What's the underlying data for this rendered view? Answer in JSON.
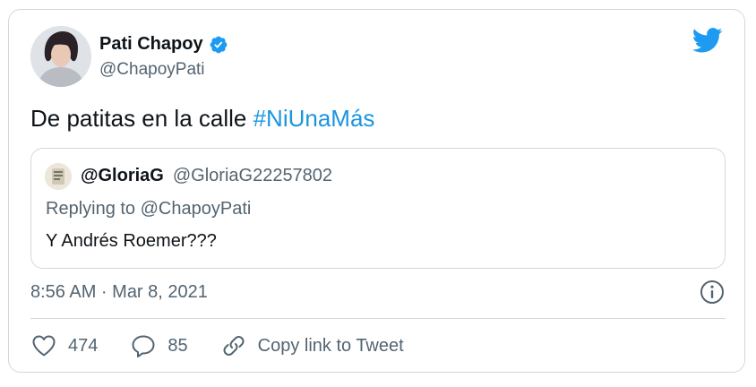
{
  "author": {
    "display_name": "Pati Chapoy",
    "handle": "@ChapoyPati",
    "verified": true
  },
  "tweet": {
    "text": "De patitas en la calle ",
    "hashtag": "#NiUnaMás"
  },
  "quoted": {
    "name": "@GloriaG",
    "handle": "@GloriaG22257802",
    "replying_to": "Replying to @ChapoyPati",
    "text": "Y Andrés Roemer???"
  },
  "timestamp": "8:56 AM · Mar 8, 2021",
  "actions": {
    "likes": "474",
    "replies": "85",
    "copy_link": "Copy link to Tweet"
  },
  "icons": {
    "bird": "twitter-bird-icon",
    "verified": "verified-badge-icon",
    "info": "info-icon",
    "like": "heart-icon",
    "reply": "comment-icon",
    "link": "link-icon"
  },
  "colors": {
    "brand_blue": "#1d9bf0",
    "hashtag": "#1b95e0",
    "secondary_text": "#536471",
    "border": "#cfd9de"
  }
}
